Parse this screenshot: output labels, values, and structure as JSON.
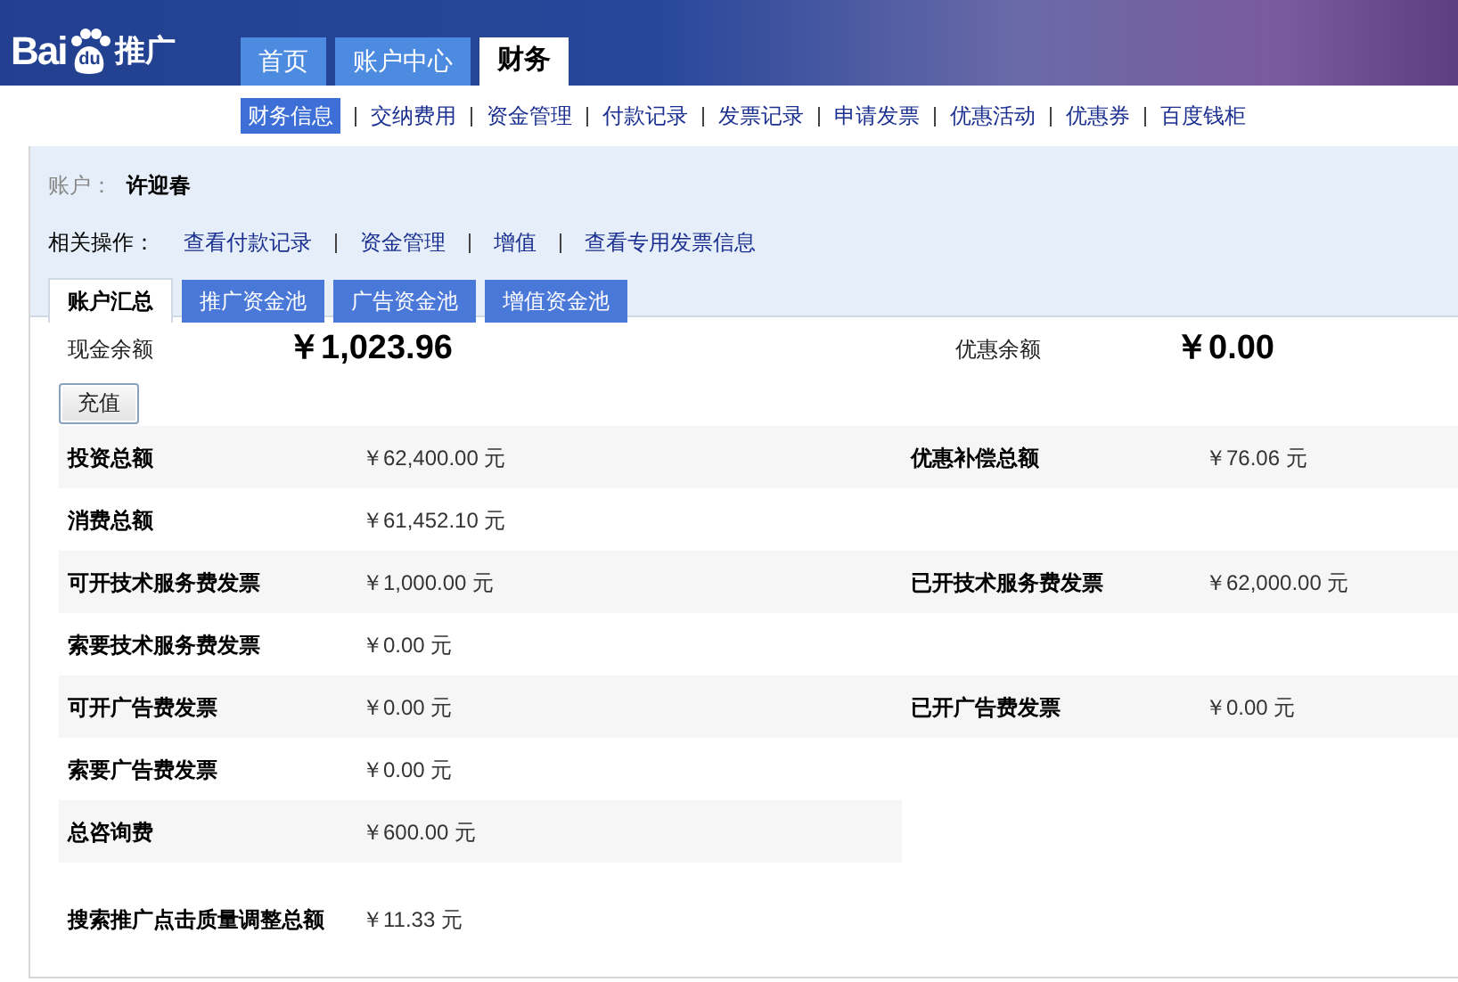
{
  "logo": {
    "part_1": "Bai",
    "part_2": "du",
    "part_3": "推广"
  },
  "top_tabs": [
    {
      "label": "首页",
      "selected": false
    },
    {
      "label": "账户中心",
      "selected": false
    },
    {
      "label": "财务",
      "selected": true
    }
  ],
  "sub_nav": [
    {
      "label": "财务信息",
      "selected": true
    },
    {
      "label": "交纳费用",
      "selected": false
    },
    {
      "label": "资金管理",
      "selected": false
    },
    {
      "label": "付款记录",
      "selected": false
    },
    {
      "label": "发票记录",
      "selected": false
    },
    {
      "label": "申请发票",
      "selected": false
    },
    {
      "label": "优惠活动",
      "selected": false
    },
    {
      "label": "优惠券",
      "selected": false
    },
    {
      "label": "百度钱柜",
      "selected": false
    }
  ],
  "account": {
    "label": "账户：",
    "name": "许迎春"
  },
  "related_actions": {
    "label": "相关操作：",
    "links": [
      "查看付款记录",
      "资金管理",
      "增值",
      "查看专用发票信息"
    ]
  },
  "tabs": [
    {
      "label": "账户汇总",
      "selected": true
    },
    {
      "label": "推广资金池",
      "selected": false
    },
    {
      "label": "广告资金池",
      "selected": false
    },
    {
      "label": "增值资金池",
      "selected": false
    }
  ],
  "balances": [
    {
      "label": "现金余额",
      "amount": "￥1,023.96"
    },
    {
      "label": "优惠余额",
      "amount": "￥0.00"
    }
  ],
  "recharge_button": "充值",
  "rows": [
    {
      "cells": [
        {
          "label": "投资总额",
          "value": "￥62,400.00 元"
        },
        {
          "label": "优惠补偿总额",
          "value": "￥76.06 元"
        }
      ]
    },
    {
      "cells": [
        {
          "label": "消费总额",
          "value": "￥61,452.10 元"
        }
      ]
    },
    {
      "cells": [
        {
          "label": "可开技术服务费发票",
          "value": "￥1,000.00 元"
        },
        {
          "label": "已开技术服务费发票",
          "value": "￥62,000.00 元"
        }
      ]
    },
    {
      "cells": [
        {
          "label": "索要技术服务费发票",
          "value": "￥0.00 元"
        }
      ]
    },
    {
      "cells": [
        {
          "label": "可开广告费发票",
          "value": "￥0.00 元"
        },
        {
          "label": "已开广告费发票",
          "value": "￥0.00 元"
        }
      ]
    },
    {
      "cells": [
        {
          "label": "索要广告费发票",
          "value": "￥0.00 元"
        }
      ]
    },
    {
      "cells": [
        {
          "label": "总咨询费",
          "value": "￥600.00 元"
        }
      ]
    },
    {
      "cells": [
        {
          "label": "搜索推广点击质量调整总额",
          "value": "￥11.33 元"
        }
      ]
    }
  ]
}
